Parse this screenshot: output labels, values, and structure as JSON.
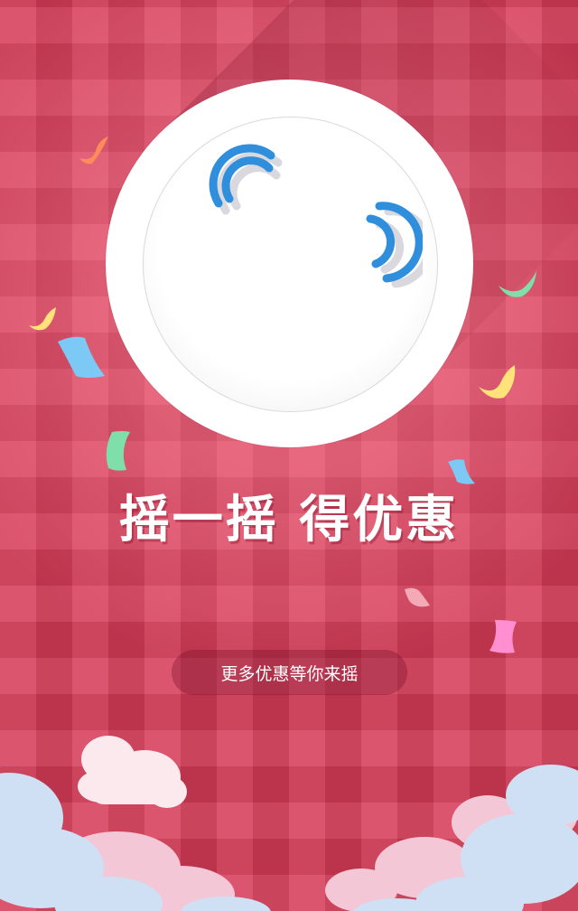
{
  "title": "摇一摇  得优惠",
  "subtitle": "更多优惠等你来摇",
  "icons": {
    "shake_plate": "shake-plate-icon",
    "signal_wave": "signal-wave-icon"
  },
  "colors": {
    "background": "#d43a56",
    "wave": "#2f8fdc",
    "cloud_blue": "#cfe0f5",
    "cloud_pink": "#f4c7d7"
  }
}
